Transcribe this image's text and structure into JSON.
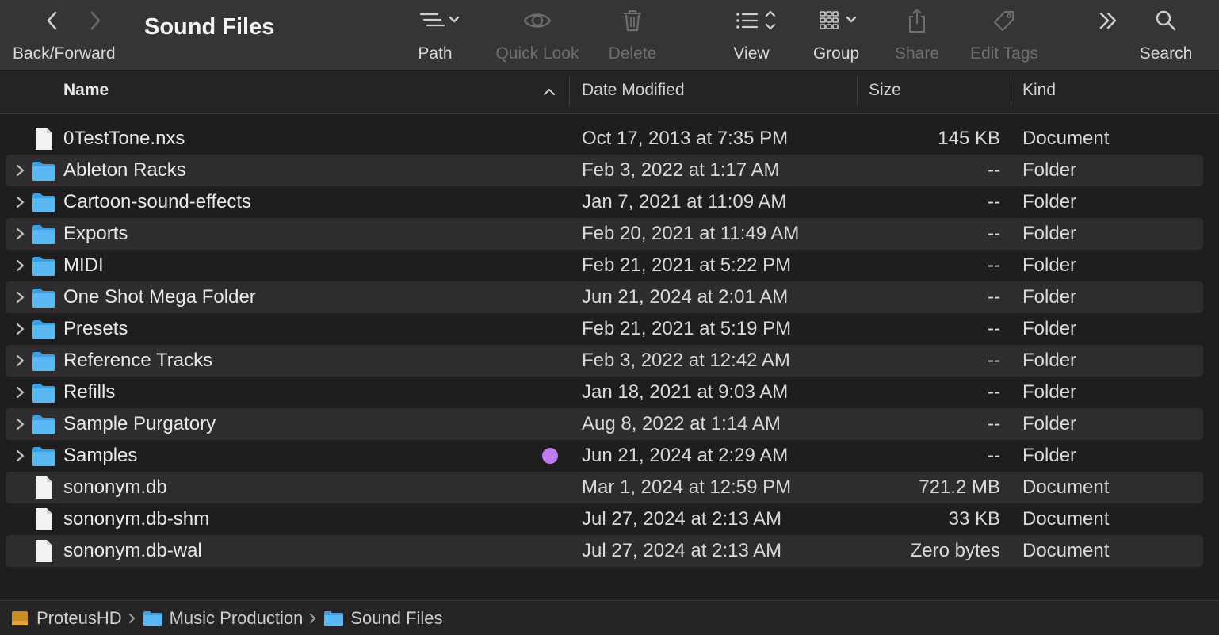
{
  "toolbar": {
    "nav_label": "Back/Forward",
    "title": "Sound Files",
    "path_label": "Path",
    "quicklook_label": "Quick Look",
    "delete_label": "Delete",
    "view_label": "View",
    "group_label": "Group",
    "share_label": "Share",
    "edittags_label": "Edit Tags",
    "search_label": "Search"
  },
  "columns": {
    "name": "Name",
    "date": "Date Modified",
    "size": "Size",
    "kind": "Kind"
  },
  "files": [
    {
      "name": "0TestTone.nxs",
      "date": "Oct 17, 2013 at 7:35 PM",
      "size": "145 KB",
      "kind": "Document",
      "type": "doc"
    },
    {
      "name": "Ableton Racks",
      "date": "Feb 3, 2022 at 1:17 AM",
      "size": "--",
      "kind": "Folder",
      "type": "folder"
    },
    {
      "name": "Cartoon-sound-effects",
      "date": "Jan 7, 2021 at 11:09 AM",
      "size": "--",
      "kind": "Folder",
      "type": "folder"
    },
    {
      "name": "Exports",
      "date": "Feb 20, 2021 at 11:49 AM",
      "size": "--",
      "kind": "Folder",
      "type": "folder"
    },
    {
      "name": "MIDI",
      "date": "Feb 21, 2021 at 5:22 PM",
      "size": "--",
      "kind": "Folder",
      "type": "folder"
    },
    {
      "name": "One Shot Mega Folder",
      "date": "Jun 21, 2024 at 2:01 AM",
      "size": "--",
      "kind": "Folder",
      "type": "folder"
    },
    {
      "name": "Presets",
      "date": "Feb 21, 2021 at 5:19 PM",
      "size": "--",
      "kind": "Folder",
      "type": "folder"
    },
    {
      "name": "Reference Tracks",
      "date": "Feb 3, 2022 at 12:42 AM",
      "size": "--",
      "kind": "Folder",
      "type": "folder"
    },
    {
      "name": "Refills",
      "date": "Jan 18, 2021 at 9:03 AM",
      "size": "--",
      "kind": "Folder",
      "type": "folder"
    },
    {
      "name": "Sample Purgatory",
      "date": "Aug 8, 2022 at 1:14 AM",
      "size": "--",
      "kind": "Folder",
      "type": "folder"
    },
    {
      "name": "Samples",
      "date": "Jun 21, 2024 at 2:29 AM",
      "size": "--",
      "kind": "Folder",
      "type": "folder",
      "tag_color": "#bf7bf0"
    },
    {
      "name": "sononym.db",
      "date": "Mar 1, 2024 at 12:59 PM",
      "size": "721.2 MB",
      "kind": "Document",
      "type": "doc"
    },
    {
      "name": "sononym.db-shm",
      "date": "Jul 27, 2024 at 2:13 AM",
      "size": "33 KB",
      "kind": "Document",
      "type": "doc"
    },
    {
      "name": "sononym.db-wal",
      "date": "Jul 27, 2024 at 2:13 AM",
      "size": "Zero bytes",
      "kind": "Document",
      "type": "doc"
    }
  ],
  "pathbar": [
    {
      "label": "ProteusHD",
      "icon": "drive-icon"
    },
    {
      "label": "Music Production",
      "icon": "folder-icon"
    },
    {
      "label": "Sound Files",
      "icon": "folder-icon"
    }
  ]
}
